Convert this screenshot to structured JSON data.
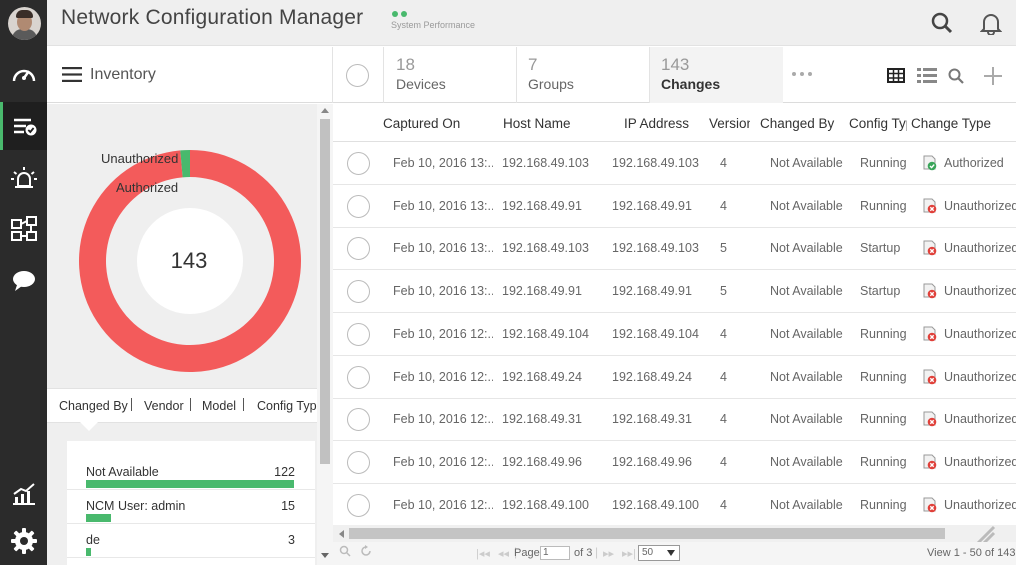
{
  "header": {
    "title": "Network Configuration Manager",
    "perf_label": "System Performance"
  },
  "subbar": {
    "title": "Inventory",
    "stats": [
      {
        "num": "18",
        "label": "Devices"
      },
      {
        "num": "7",
        "label": "Groups"
      },
      {
        "num": "143",
        "label": "Changes"
      }
    ]
  },
  "chart_data": {
    "type": "pie",
    "style": "donut",
    "categories": [
      "Unauthorized",
      "Authorized"
    ],
    "values": [
      141,
      2
    ],
    "colors": [
      "#f35b5b",
      "#49b96d"
    ],
    "center_label": "143"
  },
  "tabs": [
    "Changed By",
    "Vendor",
    "Model",
    "Config Type"
  ],
  "changers": [
    {
      "name": "Not Available",
      "count": "122",
      "fraction": 1.0
    },
    {
      "name": "NCM User: admin",
      "count": "15",
      "fraction": 0.12
    },
    {
      "name": "de",
      "count": "3",
      "fraction": 0.025
    }
  ],
  "table": {
    "columns": [
      "Captured On",
      "Host Name",
      "IP Address",
      "Version",
      "Changed By",
      "Config Type",
      "Change Type"
    ],
    "rows": [
      {
        "captured": "Feb 10, 2016 13:...",
        "host": "192.168.49.103",
        "ip": "192.168.49.103",
        "version": "4",
        "changed_by": "Not Available",
        "config": "Running",
        "change": "Authorized",
        "status": "authorized"
      },
      {
        "captured": "Feb 10, 2016 13:...",
        "host": "192.168.49.91",
        "ip": "192.168.49.91",
        "version": "4",
        "changed_by": "Not Available",
        "config": "Running",
        "change": "Unauthorized",
        "status": "unauthorized"
      },
      {
        "captured": "Feb 10, 2016 13:...",
        "host": "192.168.49.103",
        "ip": "192.168.49.103",
        "version": "5",
        "changed_by": "Not Available",
        "config": "Startup",
        "change": "Unauthorized",
        "status": "unauthorized"
      },
      {
        "captured": "Feb 10, 2016 13:...",
        "host": "192.168.49.91",
        "ip": "192.168.49.91",
        "version": "5",
        "changed_by": "Not Available",
        "config": "Startup",
        "change": "Unauthorized",
        "status": "unauthorized"
      },
      {
        "captured": "Feb 10, 2016 12:...",
        "host": "192.168.49.104",
        "ip": "192.168.49.104",
        "version": "4",
        "changed_by": "Not Available",
        "config": "Running",
        "change": "Unauthorized",
        "status": "unauthorized"
      },
      {
        "captured": "Feb 10, 2016 12:...",
        "host": "192.168.49.24",
        "ip": "192.168.49.24",
        "version": "4",
        "changed_by": "Not Available",
        "config": "Running",
        "change": "Unauthorized",
        "status": "unauthorized"
      },
      {
        "captured": "Feb 10, 2016 12:...",
        "host": "192.168.49.31",
        "ip": "192.168.49.31",
        "version": "4",
        "changed_by": "Not Available",
        "config": "Running",
        "change": "Unauthorized",
        "status": "unauthorized"
      },
      {
        "captured": "Feb 10, 2016 12:...",
        "host": "192.168.49.96",
        "ip": "192.168.49.96",
        "version": "4",
        "changed_by": "Not Available",
        "config": "Running",
        "change": "Unauthorized",
        "status": "unauthorized"
      },
      {
        "captured": "Feb 10, 2016 12:...",
        "host": "192.168.49.100",
        "ip": "192.168.49.100",
        "version": "4",
        "changed_by": "Not Available",
        "config": "Running",
        "change": "Unauthorized",
        "status": "unauthorized"
      }
    ]
  },
  "pager": {
    "page_label": "Page",
    "page_value": "1",
    "of_label": "of 3",
    "page_size": "50",
    "view_text": "View 1 - 50 of 143"
  },
  "icons": {
    "rail": [
      "avatar",
      "dashboard-icon",
      "inventory-icon",
      "alarms-icon",
      "network-icon",
      "chat-icon",
      "reports-icon",
      "settings-icon"
    ],
    "active": "inventory-icon"
  }
}
